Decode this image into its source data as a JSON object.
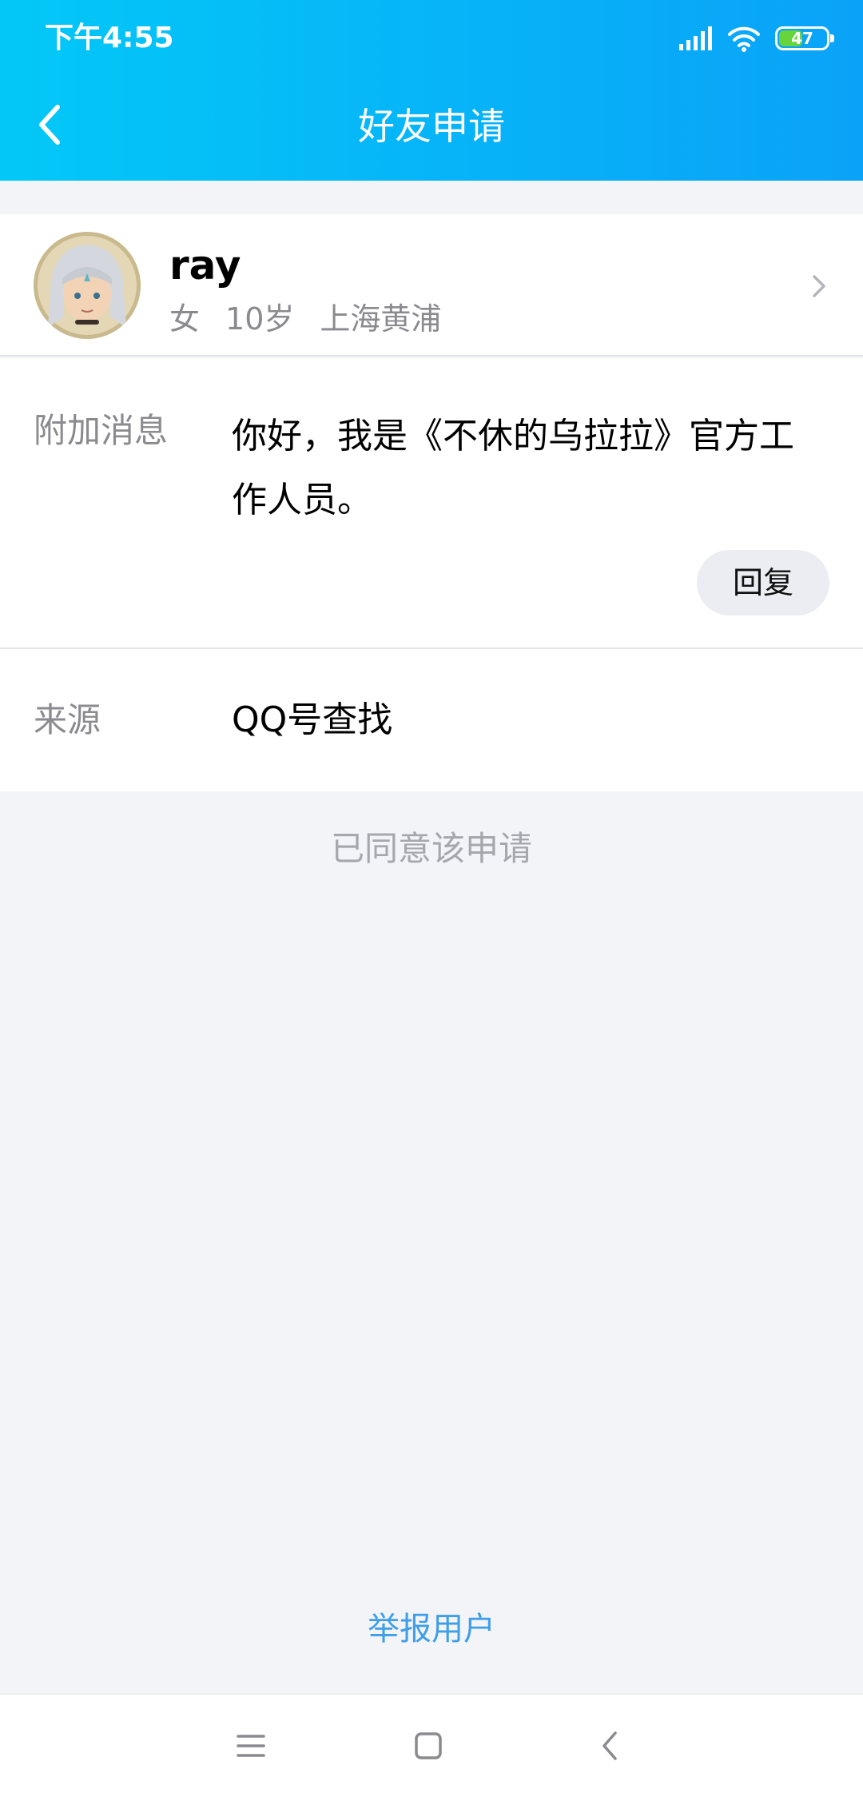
{
  "status_bar": {
    "time": "下午4:55",
    "battery": "47",
    "battery_level": 0.47
  },
  "header": {
    "title": "好友申请"
  },
  "profile": {
    "name": "ray",
    "gender": "女",
    "age": "10岁",
    "location": "上海黄浦"
  },
  "message": {
    "label": "附加消息",
    "text": "你好，我是《不休的乌拉拉》官方工作人员。",
    "reply_label": "回复"
  },
  "source": {
    "label": "来源",
    "value": "QQ号查找"
  },
  "status_text": "已同意该申请",
  "report_label": "举报用户",
  "icons": {
    "back": "back-arrow-icon",
    "chevron": "chevron-right-icon",
    "signal": "signal-icon",
    "wifi": "wifi-icon",
    "menu": "menu-icon",
    "home": "home-icon",
    "nav_back": "nav-back-icon"
  },
  "colors": {
    "header_start": "#03c8f7",
    "header_end": "#0aa2f8",
    "link": "#3e9ee8",
    "muted": "#8a8a8f"
  }
}
